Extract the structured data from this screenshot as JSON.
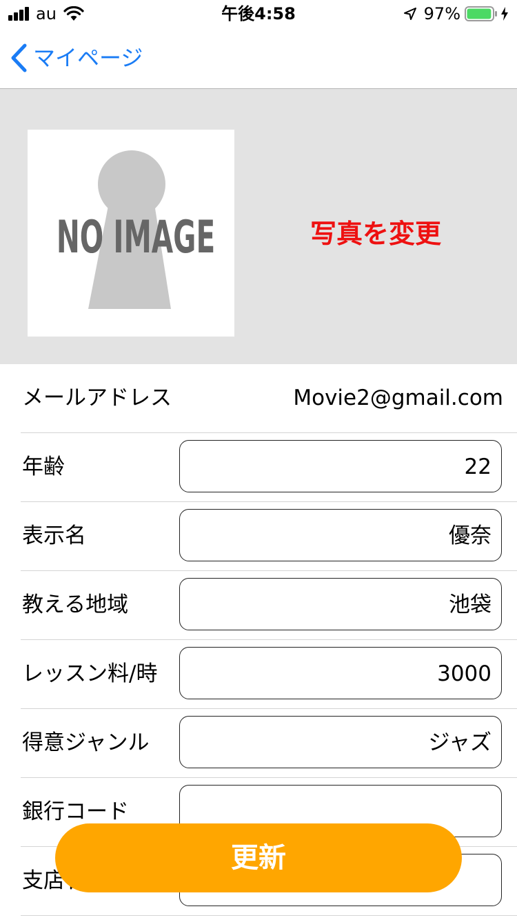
{
  "status_bar": {
    "carrier": "au",
    "time": "午後4:58",
    "battery_percent": "97%",
    "battery_level": 0.97,
    "battery_color": "#4cd964"
  },
  "nav": {
    "back_label": "マイページ",
    "accent_color": "#1a7cf5"
  },
  "photo": {
    "placeholder_text": "NO IMAGE",
    "change_label": "写真を変更",
    "change_color": "#ee1111"
  },
  "form": {
    "email": {
      "label": "メールアドレス",
      "value": "Movie2@gmail.com"
    },
    "age": {
      "label": "年齢",
      "value": "22"
    },
    "display_name": {
      "label": "表示名",
      "value": "優奈"
    },
    "teaching_area": {
      "label": "教える地域",
      "value": "池袋"
    },
    "lesson_fee": {
      "label": "レッスン料/時",
      "value": "3000"
    },
    "genre": {
      "label": "得意ジャンル",
      "value": "ジャズ"
    },
    "bank_code": {
      "label": "銀行コード",
      "value": ""
    },
    "branch": {
      "label": "支店名",
      "value": ""
    }
  },
  "update_button": {
    "label": "更新",
    "color": "#ffa600"
  }
}
